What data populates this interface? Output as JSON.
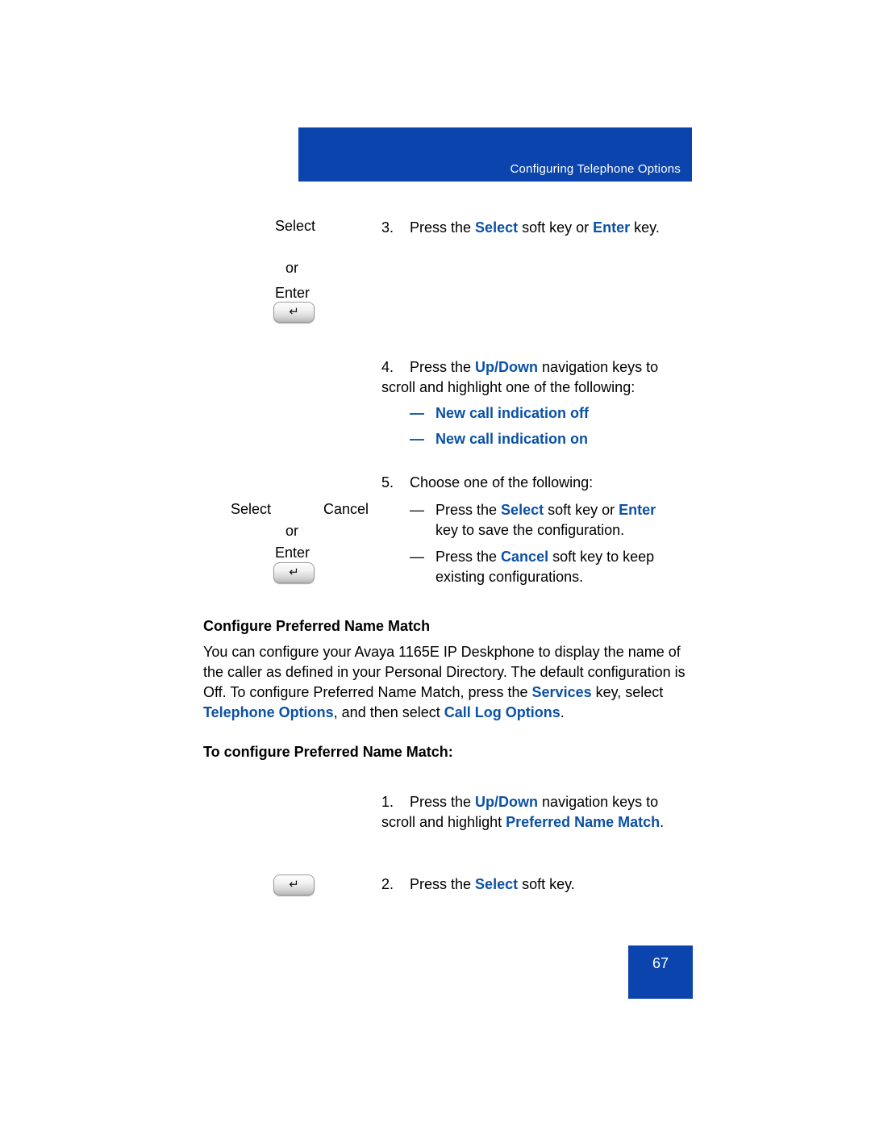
{
  "header": {
    "title": "Configuring Telephone Options",
    "banner_color": "#0a44ac"
  },
  "accent_color": "#0b51a5",
  "margin_labels": {
    "select_1": "Select",
    "or_1": "or",
    "enter_1": "Enter",
    "select_2": "Select",
    "cancel_2": "Cancel",
    "or_2": "or",
    "enter_2": "Enter"
  },
  "icons": {
    "enter_key_glyph": "↵",
    "enter_key_name": "enter-key-icon"
  },
  "steps": {
    "step3": {
      "number": "3.",
      "text_before": "Press the ",
      "bold1": "Select",
      "text_mid": " soft key or ",
      "bold2": "Enter",
      "text_after": " key."
    },
    "step4": {
      "number": "4.",
      "text_before": "Press the ",
      "bold1": "Up/Down",
      "text_after": " navigation keys to scroll and highlight one of the following:",
      "options": [
        "New call indication off",
        "New call indication on"
      ],
      "bullet_dash": "—"
    },
    "step5": {
      "number": "5.",
      "text": "Choose one of the following:",
      "bullets": [
        {
          "dash": "—",
          "text_before": "Press the ",
          "bold1": "Select",
          "text_mid": " soft key or ",
          "bold2": "Enter",
          "text_after": " key to save the configuration."
        },
        {
          "dash": "—",
          "text_before": "Press the ",
          "bold1": "Cancel",
          "text_after": " soft key to keep existing configurations."
        }
      ]
    }
  },
  "section": {
    "heading": "Configure Preferred Name Match",
    "paragraph": {
      "part1": "You can configure your Avaya 1165E IP Deskphone to display the name of the caller as defined in your Personal Directory. The default configuration is Off. To configure Preferred Name Match, press the ",
      "bold1": "Services",
      "part2": " key, select ",
      "bold2": "Telephone Options",
      "part3": ", and then select ",
      "bold3": "Call Log Options",
      "part4": "."
    },
    "subheading": "To configure Preferred Name Match:",
    "steps": [
      {
        "number": "1.",
        "text_before": "Press the ",
        "bold1": "Up/Down",
        "text_mid": " navigation keys to scroll and highlight ",
        "bold2": "Preferred Name Match",
        "text_after": "."
      },
      {
        "number": "2.",
        "text_before": "Press the ",
        "bold1": "Select",
        "text_after": " soft key."
      }
    ]
  },
  "footer": {
    "page_number": "67"
  }
}
